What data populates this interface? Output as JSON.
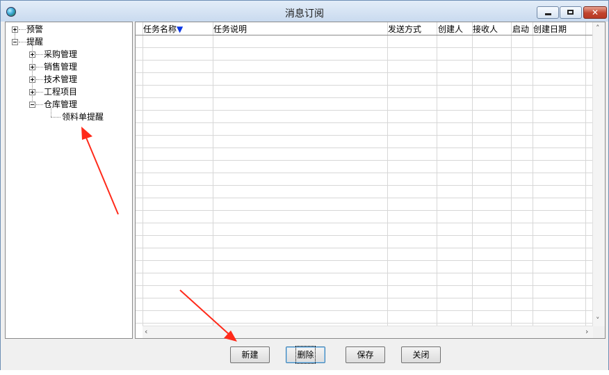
{
  "window": {
    "title": "消息订阅"
  },
  "tree": {
    "nodes": [
      {
        "label": "预警",
        "expander": "plus"
      },
      {
        "label": "提醒",
        "expander": "minus"
      },
      {
        "label": "采购管理",
        "expander": "plus"
      },
      {
        "label": "销售管理",
        "expander": "plus"
      },
      {
        "label": "技术管理",
        "expander": "plus"
      },
      {
        "label": "工程项目",
        "expander": "plus"
      },
      {
        "label": "仓库管理",
        "expander": "minus"
      },
      {
        "label": "领料单提醒",
        "expander": "none"
      }
    ]
  },
  "grid": {
    "columns": [
      "任务名称",
      "任务说明",
      "发送方式",
      "创建人",
      "接收人",
      "启动",
      "创建日期"
    ],
    "sort_indicator": "▼",
    "rows": []
  },
  "buttons": {
    "new": "新建",
    "delete": "删除",
    "save": "保存",
    "close": "关闭"
  },
  "colors": {
    "annotation_arrow": "#ff2a1a",
    "sort_arrow": "#0a36e6"
  }
}
